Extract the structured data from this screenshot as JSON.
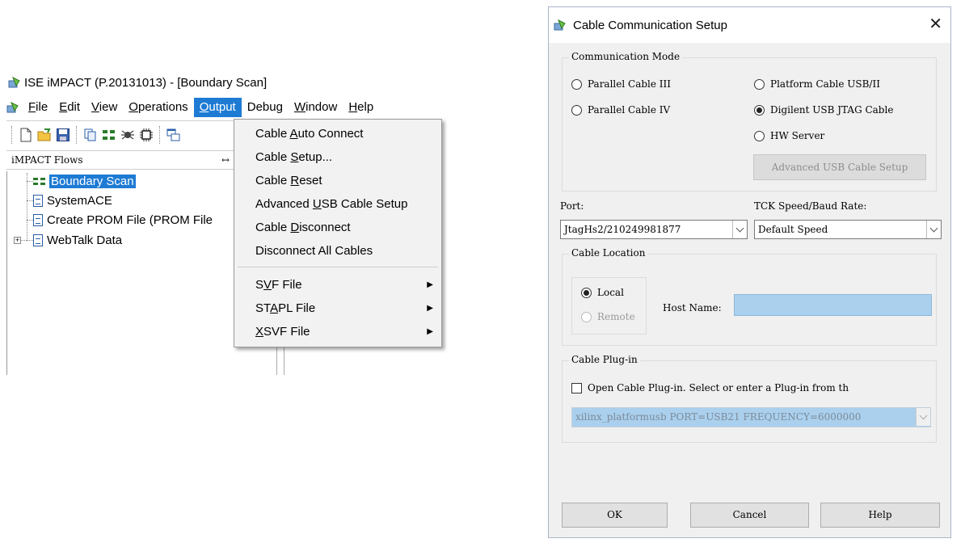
{
  "main_window": {
    "title": "ISE iMPACT (P.20131013) - [Boundary Scan]",
    "menu": [
      {
        "label": "File",
        "mnemonic_index": 0
      },
      {
        "label": "Edit",
        "mnemonic_index": 0
      },
      {
        "label": "View",
        "mnemonic_index": 0
      },
      {
        "label": "Operations",
        "mnemonic_index": 0
      },
      {
        "label": "Output",
        "mnemonic_index": 0
      },
      {
        "label": "Debug",
        "mnemonic_index": 4
      },
      {
        "label": "Window",
        "mnemonic_index": 0
      },
      {
        "label": "Help",
        "mnemonic_index": 0
      }
    ],
    "toolbar_icons": [
      "new-file-icon",
      "open-folder-icon",
      "save-icon",
      "copy-icon",
      "chain-icon",
      "debug-icon",
      "chip-icon",
      "cascade-icon"
    ],
    "flows_panel": {
      "title": "iMPACT Flows",
      "resize_glyph": "↔",
      "items": [
        {
          "label": "Boundary Scan",
          "icon": "boundary-scan-icon",
          "selected": true
        },
        {
          "label": "SystemACE",
          "icon": "document-icon"
        },
        {
          "label": "Create PROM File (PROM File",
          "icon": "document-icon"
        },
        {
          "label": "WebTalk Data",
          "icon": "document-icon",
          "expander": "+"
        }
      ]
    },
    "output_menu": {
      "items": [
        {
          "pre": "Cable ",
          "mn": "A",
          "post": "uto Connect"
        },
        {
          "pre": "Cable ",
          "mn": "S",
          "post": "etup..."
        },
        {
          "pre": "Cable ",
          "mn": "R",
          "post": "eset"
        },
        {
          "pre": "Advanced ",
          "mn": "U",
          "post": "SB Cable Setup"
        },
        {
          "pre": "Cable ",
          "mn": "D",
          "post": "isconnect"
        },
        {
          "pre": "Disconnect All Cables",
          "mn": "",
          "post": ""
        }
      ],
      "submenus": [
        {
          "pre": "S",
          "mn": "V",
          "post": "F File",
          "arrow": "▶"
        },
        {
          "pre": "ST",
          "mn": "A",
          "post": "PL File",
          "arrow": "▶"
        },
        {
          "pre": "",
          "mn": "X",
          "post": "SVF File",
          "arrow": "▶"
        }
      ]
    }
  },
  "dialog": {
    "title": "Cable Communication Setup",
    "close_glyph": "✕",
    "communication_mode": {
      "legend": "Communication Mode",
      "options": [
        {
          "label": "Parallel Cable III",
          "checked": false
        },
        {
          "label": "Parallel Cable IV",
          "checked": false
        },
        {
          "label": "Platform Cable USB/II",
          "checked": false
        },
        {
          "label": "Digilent USB JTAG Cable",
          "checked": true
        },
        {
          "label": "HW Server",
          "checked": false
        }
      ],
      "advanced_button": "Advanced USB Cable Setup"
    },
    "port": {
      "label": "Port:",
      "value": "JtagHs2/210249981877"
    },
    "tck_speed": {
      "label": "TCK Speed/Baud Rate:",
      "value": "Default Speed"
    },
    "cable_location": {
      "legend": "Cable Location",
      "local_label": "Local",
      "remote_label": "Remote",
      "local_checked": true,
      "host_name_label": "Host Name:",
      "host_name_value": ""
    },
    "cable_plugin": {
      "legend": "Cable Plug-in",
      "checkbox_label": "Open Cable Plug-in. Select or enter a Plug-in from th",
      "checked": false,
      "value": "xilinx_platformusb PORT=USB21 FREQUENCY=6000000"
    },
    "buttons": {
      "ok": "OK",
      "cancel": "Cancel",
      "help": "Help"
    }
  },
  "colors": {
    "selection": "#1e7bd4",
    "host_field": "#aad0ee",
    "plugin_field": "#aad0ee"
  }
}
